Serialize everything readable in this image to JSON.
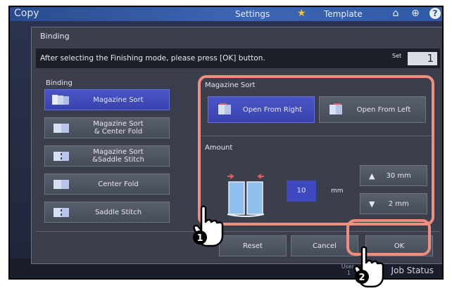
{
  "topbar": {
    "title": "Copy",
    "settings": "Settings",
    "template": "Template",
    "icons": [
      "star-icon",
      "home-icon",
      "globe-icon",
      "help-icon"
    ]
  },
  "dialog": {
    "title": "Binding",
    "instruction": "After selecting the Finishing mode, please press [OK] button.",
    "set_label": "Set",
    "set_value": "1"
  },
  "binding": {
    "label": "Binding",
    "options": [
      {
        "label": "Magazine Sort",
        "selected": true
      },
      {
        "label": "Magazine Sort\n& Center Fold",
        "selected": false
      },
      {
        "label": "Magazine Sort\n&Saddle Stitch",
        "selected": false
      },
      {
        "label": "Center Fold",
        "selected": false
      },
      {
        "label": "Saddle Stitch",
        "selected": false
      }
    ]
  },
  "magazine_sort": {
    "label": "Magazine Sort",
    "open_right": "Open From Right",
    "open_left": "Open From Left"
  },
  "amount": {
    "label": "Amount",
    "value": "10",
    "unit": "mm",
    "max": "30 mm",
    "min": "2 mm"
  },
  "buttons": {
    "reset": "Reset",
    "cancel": "Cancel",
    "ok": "OK"
  },
  "bottom": {
    "job_status": "Job Status",
    "small1": "User",
    "small2": "1"
  },
  "callouts": [
    "1",
    "2"
  ],
  "colors": {
    "selected": "#3d47bf",
    "highlight": "#ee8e7e",
    "topbar": "#3d66b5"
  }
}
